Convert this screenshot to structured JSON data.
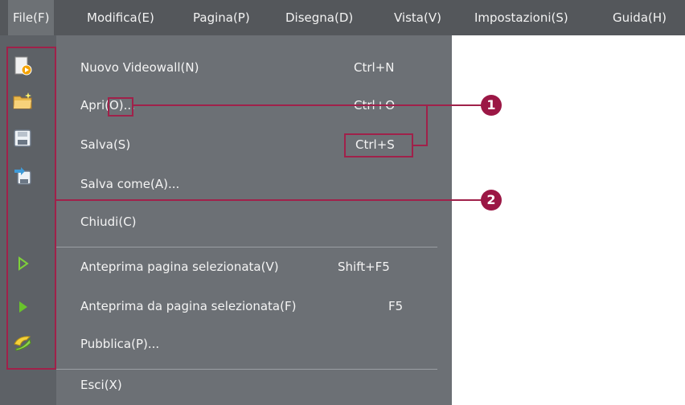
{
  "menubar": {
    "items": [
      {
        "label": "File(F)"
      },
      {
        "label": "Modifica(E)"
      },
      {
        "label": "Pagina(P)"
      },
      {
        "label": "Disegna(D)"
      },
      {
        "label": "Vista(V)"
      },
      {
        "label": "Impostazioni(S)"
      },
      {
        "label": "Guida(H)"
      }
    ]
  },
  "file_menu": {
    "items": [
      {
        "label": "Nuovo Videowall(N)",
        "shortcut": "Ctrl+N"
      },
      {
        "label": "Apri(O)...",
        "shortcut": "Ctrl+O"
      },
      {
        "label": "Salva(S)",
        "shortcut": "Ctrl+S"
      },
      {
        "label": "Salva come(A)...",
        "shortcut": ""
      },
      {
        "label": "Chiudi(C)",
        "shortcut": ""
      },
      {
        "label": "Anteprima pagina selezionata(V)",
        "shortcut": "Shift+F5"
      },
      {
        "label": "Anteprima da pagina selezionata(F)",
        "shortcut": "F5"
      },
      {
        "label": "Pubblica(P)...",
        "shortcut": ""
      },
      {
        "label": "Esci(X)",
        "shortcut": ""
      }
    ]
  },
  "callouts": {
    "one": "1",
    "two": "2"
  },
  "colors": {
    "highlight": "#a0214a",
    "menu_bg": "#6c7075",
    "menubar_bg": "#54575b"
  },
  "icons": [
    "new-videowall-icon",
    "open-folder-icon",
    "save-disk-icon",
    "save-as-icon",
    "preview-selected-icon",
    "preview-from-selected-icon",
    "publish-icon"
  ]
}
